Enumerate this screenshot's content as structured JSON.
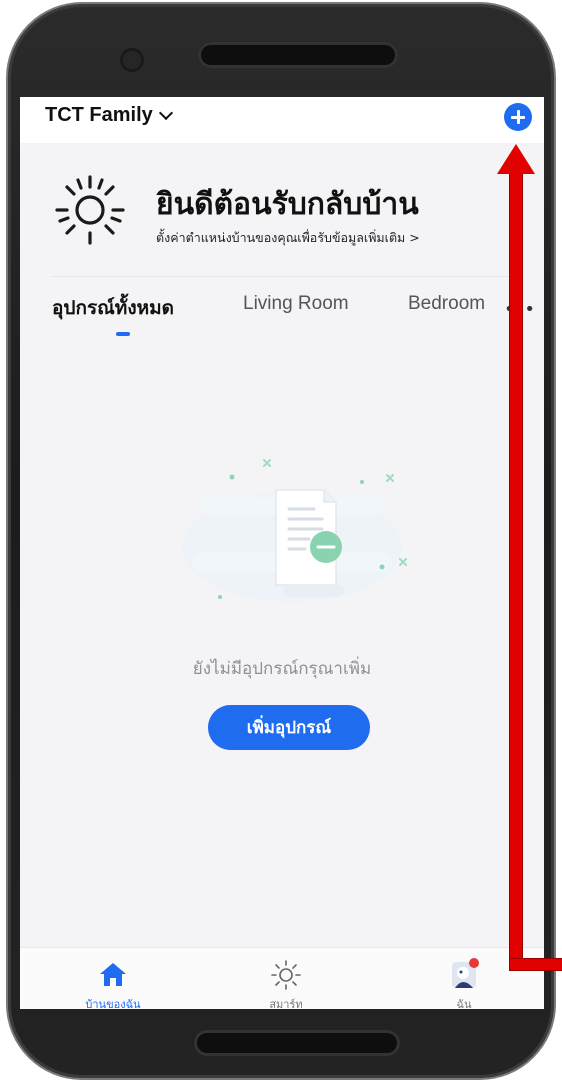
{
  "header": {
    "family_name": "TCT Family",
    "add_icon": "plus-circle-icon"
  },
  "welcome": {
    "title": "ยินดีต้อนรับกลับบ้าน",
    "subtitle": "ตั้งค่าตำแหน่งบ้านของคุณเพื่อรับข้อมูลเพิ่มเติม >",
    "icon": "sun-icon"
  },
  "tabs": {
    "items": [
      {
        "label": "อุปกรณ์ทั้งหมด",
        "active": true
      },
      {
        "label": "Living Room",
        "active": false
      },
      {
        "label": "Bedroom",
        "active": false
      }
    ],
    "more": "• •"
  },
  "empty_state": {
    "message": "ยังไม่มีอุปกรณ์กรุณาเพิ่ม",
    "button": "เพิ่มอุปกรณ์"
  },
  "bottom_nav": {
    "items": [
      {
        "label": "บ้านของฉัน",
        "icon": "home-icon",
        "active": true
      },
      {
        "label": "สมาร์ท",
        "icon": "sun-icon",
        "active": false
      },
      {
        "label": "ฉัน",
        "icon": "avatar-icon",
        "active": false
      }
    ]
  },
  "colors": {
    "accent": "#1f6cf0",
    "annotation_arrow": "#e30000"
  }
}
